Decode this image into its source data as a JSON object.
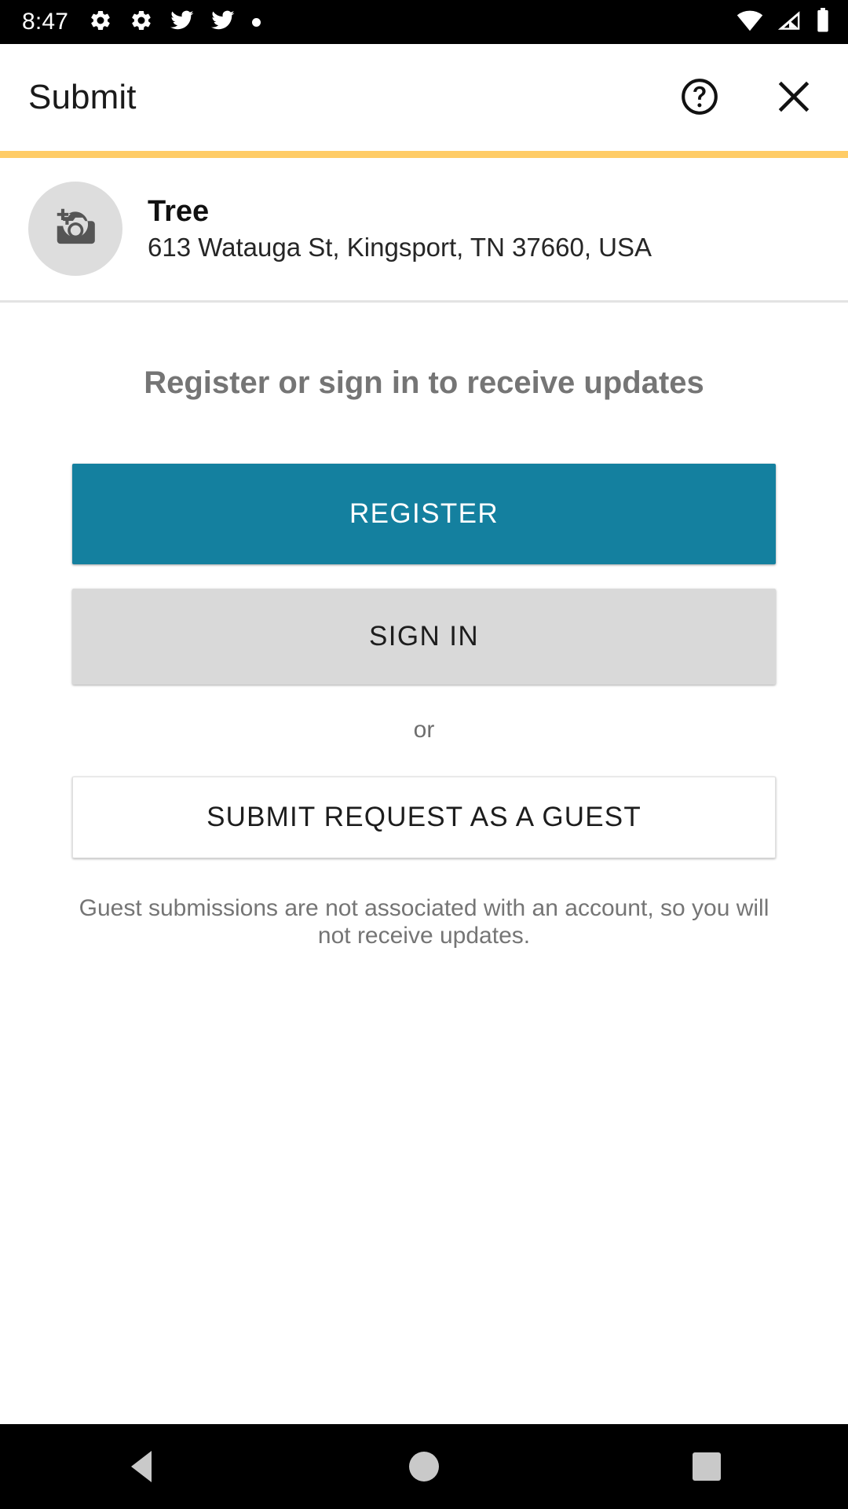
{
  "status_bar": {
    "clock": "8:47",
    "left_icons": [
      "settings-gear-icon",
      "settings-gear-icon",
      "twitter-bird-icon",
      "twitter-bird-icon",
      "notification-dot-icon"
    ],
    "right_icons": [
      "wifi-icon",
      "cellular-signal-icon",
      "battery-icon"
    ]
  },
  "app_bar": {
    "title": "Submit",
    "help_icon": "help-circle-icon",
    "close_icon": "close-x-icon",
    "accent_color": "#ffcc66"
  },
  "place": {
    "photo_icon": "add-photo-camera-icon",
    "name": "Tree",
    "address": "613 Watauga St, Kingsport, TN 37660, USA"
  },
  "auth": {
    "heading": "Register or sign in to receive updates",
    "register_label": "REGISTER",
    "register_color": "#14809f",
    "signin_label": "SIGN IN",
    "signin_color": "#d9d9d9",
    "or_label": "or",
    "guest_label": "SUBMIT REQUEST AS A GUEST",
    "guest_note": "Guest submissions are not associated with an account, so you will not receive updates."
  },
  "nav_bar": {
    "back": "back-triangle-icon",
    "home": "home-circle-icon",
    "recents": "recents-square-icon"
  }
}
